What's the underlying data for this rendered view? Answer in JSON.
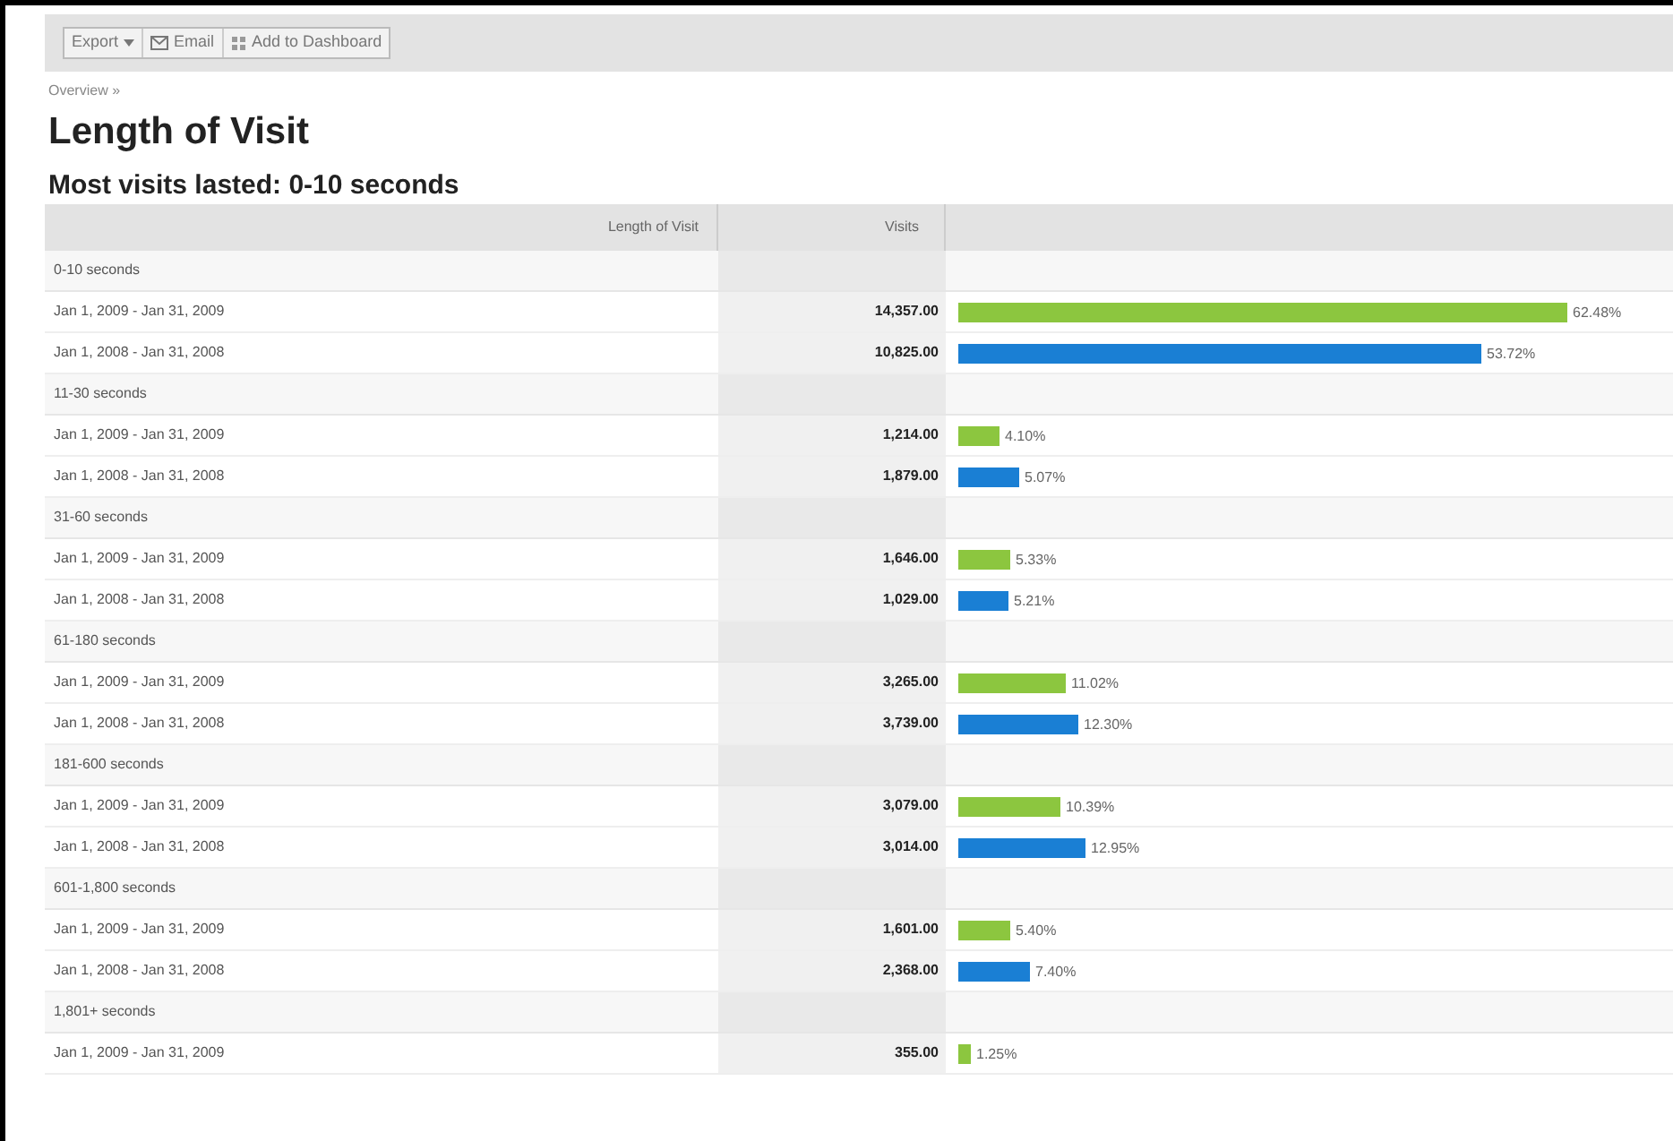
{
  "toolbar": {
    "buttons": [
      {
        "label": "Export",
        "dropdown": true
      },
      {
        "label": "Email",
        "dropdown": false
      },
      {
        "label": "Add to Dashboard",
        "dropdown": false
      }
    ]
  },
  "breadcrumb": "Overview »",
  "title": "Length of Visit",
  "subtitle": "Most visits lasted: 0-10 seconds",
  "table": {
    "columns": [
      "Length of Visit",
      "Visits"
    ],
    "groups": [
      {
        "label": "0-10 seconds",
        "rows": [
          {
            "period": "Jan 1, 2009 - Jan 31, 2009",
            "visits": "14,357.00",
            "percent": "62.48%",
            "color": "#8cc63f"
          },
          {
            "period": "Jan 1, 2008 - Jan 31, 2008",
            "visits": "10,825.00",
            "percent": "53.72%",
            "color": "#1a7fd4"
          }
        ]
      },
      {
        "label": "11-30 seconds",
        "rows": [
          {
            "period": "Jan 1, 2009 - Jan 31, 2009",
            "visits": "1,214.00",
            "percent": "4.10%",
            "color": "#8cc63f"
          },
          {
            "period": "Jan 1, 2008 - Jan 31, 2008",
            "visits": "1,879.00",
            "percent": "5.07%",
            "color": "#1a7fd4"
          }
        ]
      },
      {
        "label": "31-60 seconds",
        "rows": [
          {
            "period": "Jan 1, 2009 - Jan 31, 2009",
            "visits": "1,646.00",
            "percent": "5.33%",
            "color": "#8cc63f"
          },
          {
            "period": "Jan 1, 2008 - Jan 31, 2008",
            "visits": "1,029.00",
            "percent": "5.21%",
            "color": "#1a7fd4"
          }
        ]
      },
      {
        "label": "61-180 seconds",
        "rows": [
          {
            "period": "Jan 1, 2009 - Jan 31, 2009",
            "visits": "3,265.00",
            "percent": "11.02%",
            "color": "#8cc63f"
          },
          {
            "period": "Jan 1, 2008 - Jan 31, 2008",
            "visits": "3,739.00",
            "percent": "12.30%",
            "color": "#1a7fd4"
          }
        ]
      },
      {
        "label": "181-600 seconds",
        "rows": [
          {
            "period": "Jan 1, 2009 - Jan 31, 2009",
            "visits": "3,079.00",
            "percent": "10.39%",
            "color": "#8cc63f"
          },
          {
            "period": "Jan 1, 2008 - Jan 31, 2008",
            "visits": "3,014.00",
            "percent": "12.95%",
            "color": "#1a7fd4"
          }
        ]
      },
      {
        "label": "601-1,800 seconds",
        "rows": [
          {
            "period": "Jan 1, 2009 - Jan 31, 2009",
            "visits": "1,601.00",
            "percent": "5.40%",
            "color": "#8cc63f"
          },
          {
            "period": "Jan 1, 2008 - Jan 31, 2008",
            "visits": "2,368.00",
            "percent": "7.40%",
            "color": "#1a7fd4"
          }
        ]
      },
      {
        "label": "1,801+ seconds",
        "rows": [
          {
            "period": "Jan 1, 2009 - Jan 31, 2009",
            "visits": "355.00",
            "percent": "1.25%",
            "color": "#8cc63f"
          }
        ]
      }
    ]
  }
}
